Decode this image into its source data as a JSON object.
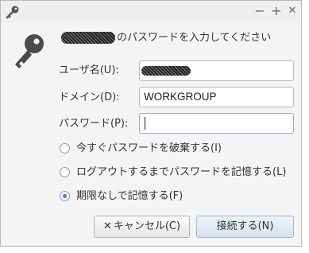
{
  "titlebar": {
    "minimize": "−",
    "maximize": "+",
    "close": "✕"
  },
  "dialog": {
    "message": "のパスワードを入力してください",
    "fields": {
      "username_label": "ユーザ名(U):",
      "domain_label": "ドメイン(D):",
      "domain_value": "WORKGROUP",
      "password_label": "パスワード(P):",
      "password_value": ""
    },
    "options": [
      {
        "label": "今すぐパスワードを破棄する(I)",
        "selected": false
      },
      {
        "label": "ログアウトするまでパスワードを記憶する(L)",
        "selected": false
      },
      {
        "label": "期限なしで記憶する(F)",
        "selected": true
      }
    ],
    "buttons": {
      "cancel_icon": "✕",
      "cancel": "キャンセル(C)",
      "connect": "接続する(N)"
    }
  },
  "icons": {
    "titlebar": "key-icon",
    "dialog": "key-icon"
  }
}
